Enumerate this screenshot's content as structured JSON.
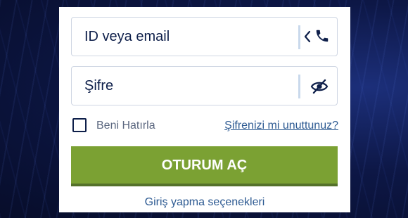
{
  "login": {
    "id_placeholder": "ID veya email",
    "password_placeholder": "Şifre",
    "remember_label": "Beni Hatırla",
    "forgot_link": "Şifrenizi mi unuttunuz?",
    "submit_label": "OTURUM AÇ",
    "options_link": "Giriş yapma seçenekleri"
  },
  "icons": {
    "id_toggle": "chevron-left-icon",
    "id_phone": "phone-icon",
    "password_visibility": "eye-slash-icon"
  },
  "colors": {
    "primary_button": "#7ba133",
    "text_dark": "#0e1f4a",
    "link": "#2d5a92",
    "background": "#0b1436"
  }
}
